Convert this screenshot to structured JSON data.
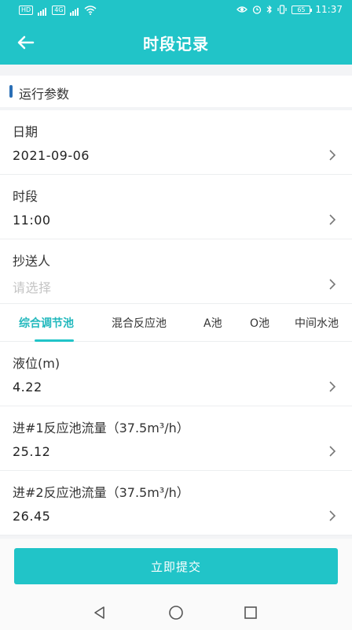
{
  "status_bar": {
    "left_badges": [
      "HD",
      "4G"
    ],
    "battery": "65",
    "time": "11:37"
  },
  "header": {
    "title": "时段记录"
  },
  "section": {
    "title": "运行参数"
  },
  "fields": {
    "date": {
      "label": "日期",
      "value": "2021-09-06"
    },
    "period": {
      "label": "时段",
      "value": "11:00"
    },
    "cc": {
      "label": "抄送人",
      "placeholder": "请选择"
    }
  },
  "tabs": [
    "综合调节池",
    "混合反应池",
    "A池",
    "O池",
    "中间水池"
  ],
  "active_tab": 0,
  "params": [
    {
      "label": "液位(m)",
      "value": "4.22"
    },
    {
      "label": "进#1反应池流量（37.5m³/h）",
      "value": "25.12"
    },
    {
      "label": "进#2反应池流量（37.5m³/h）",
      "value": "26.45"
    }
  ],
  "footer": {
    "submit_label": "立即提交"
  },
  "icons": {
    "back": "arrow-left-icon",
    "chevron": "chevron-right-icon",
    "nav": [
      "nav-back-icon",
      "nav-home-icon",
      "nav-recents-icon"
    ]
  },
  "colors": {
    "accent": "#21c4c8",
    "section_mark": "#2a6fb6",
    "placeholder": "#c4c4c4"
  }
}
